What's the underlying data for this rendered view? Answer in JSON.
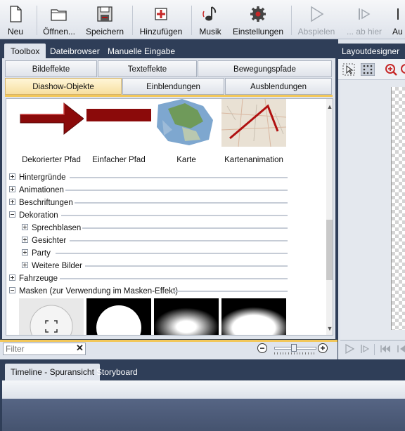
{
  "toolbar": {
    "new": "Neu",
    "open": "Öffnen...",
    "save": "Speichern",
    "add": "Hinzufügen",
    "music": "Musik",
    "settings": "Einstellungen",
    "play": "Abspielen",
    "play_from_here": "... ab hier",
    "cut": "Au"
  },
  "dock_tabs": [
    "Toolbox",
    "Dateibrowser",
    "Manuelle Eingabe"
  ],
  "category_tabs_row1": [
    "Bildeffekte",
    "Texteffekte",
    "Bewegungspfade"
  ],
  "category_tabs_row2": [
    "Diashow-Objekte",
    "Einblendungen",
    "Ausblendungen"
  ],
  "thumbnails": [
    {
      "label": "Dekorierter Pfad"
    },
    {
      "label": "Einfacher Pfad"
    },
    {
      "label": "Karte"
    },
    {
      "label": "Kartenanimation"
    }
  ],
  "tree": [
    {
      "label": "Hintergründe",
      "state": "plus"
    },
    {
      "label": "Animationen",
      "state": "plus"
    },
    {
      "label": "Beschriftungen",
      "state": "plus"
    },
    {
      "label": "Dekoration",
      "state": "minus"
    },
    {
      "label": "Sprechblasen",
      "state": "plus"
    },
    {
      "label": "Gesichter",
      "state": "plus"
    },
    {
      "label": "Party",
      "state": "plus"
    },
    {
      "label": "Weitere Bilder",
      "state": "plus"
    },
    {
      "label": "Fahrzeuge",
      "state": "plus"
    },
    {
      "label": "Masken (zur Verwendung im Masken-Effekt)",
      "state": "minus"
    }
  ],
  "filter": {
    "placeholder": "Filter"
  },
  "layout_designer": {
    "title": "Layoutdesigner"
  },
  "timeline_tabs": [
    "Timeline - Spuransicht",
    "Storyboard"
  ],
  "colors": {
    "accent": "#f2c75a",
    "dark": "#2f3e58",
    "path_red": "#8b0a0a"
  }
}
